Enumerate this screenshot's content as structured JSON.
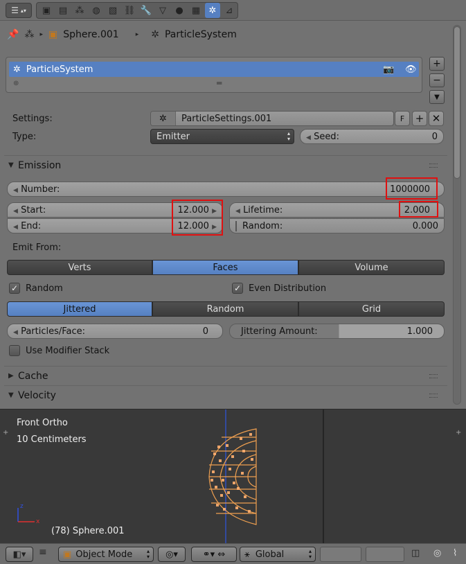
{
  "topbar": {
    "editor_type_icon": "properties-editor-icon",
    "tabs": [
      {
        "icon": "render-icon",
        "glyph": "▣"
      },
      {
        "icon": "render-layers-icon",
        "glyph": "▤"
      },
      {
        "icon": "scene-icon",
        "glyph": "⁂"
      },
      {
        "icon": "world-icon",
        "glyph": "◍"
      },
      {
        "icon": "object-icon",
        "glyph": "▧"
      },
      {
        "icon": "constraints-icon",
        "glyph": "⛓"
      },
      {
        "icon": "modifiers-icon",
        "glyph": "🔧"
      },
      {
        "icon": "data-icon",
        "glyph": "▽"
      },
      {
        "icon": "material-icon",
        "glyph": "●"
      },
      {
        "icon": "texture-icon",
        "glyph": "▦"
      },
      {
        "icon": "particles-icon",
        "glyph": "✲"
      },
      {
        "icon": "physics-icon",
        "glyph": "⊿"
      }
    ]
  },
  "breadcrumb": {
    "object": "Sphere.001",
    "particle_system": "ParticleSystem"
  },
  "system_list": {
    "item_label": "ParticleSystem"
  },
  "settings": {
    "settings_label": "Settings:",
    "settings_value": "ParticleSettings.001",
    "fake_user": "F",
    "type_label": "Type:",
    "type_value": "Emitter",
    "seed_label": "Seed:",
    "seed_value": "0"
  },
  "emission": {
    "title": "Emission",
    "number_label": "Number:",
    "number_value": "1000000",
    "start_label": "Start:",
    "start_value": "12.000",
    "end_label": "End:",
    "end_value": "12.000",
    "lifetime_label": "Lifetime:",
    "lifetime_value": "2.000",
    "random_label": "Random:",
    "random_value": "0.000",
    "emit_from_label": "Emit From:",
    "emit_from_options": [
      "Verts",
      "Faces",
      "Volume"
    ],
    "random_check": "Random",
    "even_dist_check": "Even Distribution",
    "distribution_options": [
      "Jittered",
      "Random",
      "Grid"
    ],
    "particles_face_label": "Particles/Face:",
    "particles_face_value": "0",
    "jitter_label": "Jittering Amount:",
    "jitter_value": "1.000",
    "modifier_stack": "Use Modifier Stack"
  },
  "panels": {
    "cache": "Cache",
    "velocity": "Velocity"
  },
  "viewport": {
    "view_name": "Front Ortho",
    "scale": "10 Centimeters",
    "object_info": "(78) Sphere.001"
  },
  "bottom_bar": {
    "mode": "Object Mode",
    "orientation": "Global"
  },
  "colors": {
    "accent": "#5680c2",
    "highlight": "#e01010",
    "mesh": "#f0a050"
  }
}
